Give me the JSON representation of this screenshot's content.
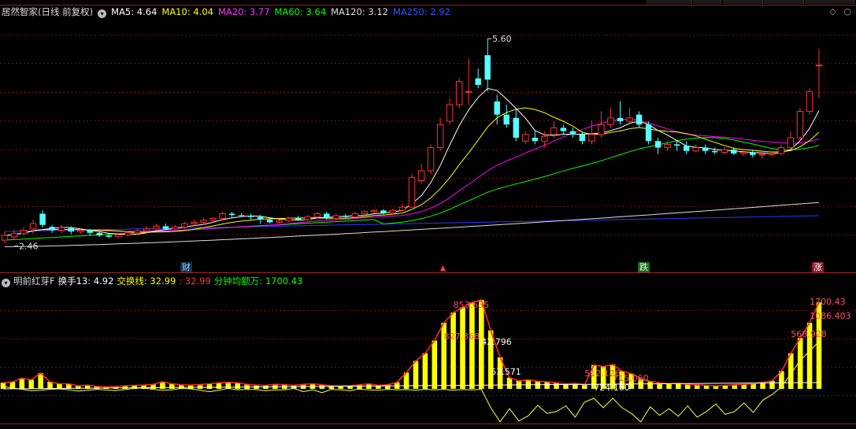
{
  "main_legend": {
    "title": "居然智家(日线 前复权)",
    "ma5": "MA5: 4.64",
    "ma10": "MA10: 4.04",
    "ma20": "MA20: 3.77",
    "ma60": "MA60: 3.64",
    "ma120": "MA120: 3.12",
    "ma250": "MA250: 2.92",
    "colors": {
      "ma5": "#ffffff",
      "ma10": "#ffff00",
      "ma20": "#ff00ff",
      "ma60": "#00ff00",
      "ma120": "#dddddd",
      "ma250": "#3333ff"
    }
  },
  "sub_legend": {
    "title": "明前红芽F",
    "turnover": "换手13: 4.92",
    "cross_label": "交换线: 32.99",
    "cross_value": ": 32.99",
    "amount": "分钟均额万: 1700.43"
  },
  "markers": {
    "cai": "财",
    "die": "跌",
    "zhang": "涨"
  },
  "chart_data": [
    {
      "type": "candlestick",
      "yrange": [
        2.3,
        5.9
      ],
      "annotations": [
        {
          "text": "5.60",
          "x_index": 51,
          "y": 5.6
        },
        {
          "text": "2.46",
          "x_index": 1,
          "y": 2.46
        }
      ],
      "candles": [
        [
          2.55,
          2.62,
          2.5,
          2.68
        ],
        [
          2.6,
          2.65,
          2.56,
          2.7
        ],
        [
          2.65,
          2.7,
          2.62,
          2.74
        ],
        [
          2.72,
          2.8,
          2.65,
          2.86
        ],
        [
          2.95,
          2.78,
          2.74,
          3.0
        ],
        [
          2.75,
          2.7,
          2.66,
          2.78
        ],
        [
          2.7,
          2.74,
          2.66,
          2.78
        ],
        [
          2.73,
          2.68,
          2.64,
          2.76
        ],
        [
          2.68,
          2.7,
          2.64,
          2.73
        ],
        [
          2.7,
          2.66,
          2.62,
          2.72
        ],
        [
          2.66,
          2.62,
          2.6,
          2.68
        ],
        [
          2.62,
          2.6,
          2.58,
          2.66
        ],
        [
          2.6,
          2.63,
          2.58,
          2.66
        ],
        [
          2.63,
          2.66,
          2.6,
          2.68
        ],
        [
          2.66,
          2.69,
          2.63,
          2.72
        ],
        [
          2.69,
          2.72,
          2.66,
          2.76
        ],
        [
          2.72,
          2.76,
          2.7,
          2.8
        ],
        [
          2.76,
          2.72,
          2.7,
          2.8
        ],
        [
          2.72,
          2.75,
          2.7,
          2.78
        ],
        [
          2.75,
          2.8,
          2.72,
          2.83
        ],
        [
          2.8,
          2.82,
          2.76,
          2.86
        ],
        [
          2.82,
          2.85,
          2.78,
          2.88
        ],
        [
          2.85,
          2.88,
          2.82,
          2.9
        ],
        [
          2.88,
          2.95,
          2.85,
          2.98
        ],
        [
          2.95,
          2.93,
          2.9,
          2.98
        ],
        [
          2.93,
          2.92,
          2.9,
          2.96
        ],
        [
          2.92,
          2.9,
          2.86,
          2.95
        ],
        [
          2.9,
          2.86,
          2.8,
          2.93
        ],
        [
          2.86,
          2.82,
          2.8,
          2.9
        ],
        [
          2.82,
          2.84,
          2.8,
          2.86
        ],
        [
          2.84,
          2.88,
          2.82,
          2.9
        ],
        [
          2.88,
          2.86,
          2.84,
          2.92
        ],
        [
          2.86,
          2.9,
          2.84,
          2.93
        ],
        [
          2.9,
          2.95,
          2.88,
          2.98
        ],
        [
          2.95,
          2.88,
          2.86,
          2.98
        ],
        [
          2.88,
          2.92,
          2.86,
          2.95
        ],
        [
          2.92,
          2.9,
          2.88,
          2.95
        ],
        [
          2.9,
          2.95,
          2.88,
          2.98
        ],
        [
          2.95,
          2.98,
          2.92,
          3.0
        ],
        [
          2.98,
          3.0,
          2.96,
          3.02
        ],
        [
          3.0,
          2.96,
          2.94,
          3.02
        ],
        [
          2.96,
          3.0,
          2.94,
          3.03
        ],
        [
          3.0,
          3.05,
          2.98,
          3.1
        ],
        [
          3.05,
          3.5,
          3.05,
          3.55
        ],
        [
          3.45,
          3.6,
          3.4,
          3.7
        ],
        [
          3.6,
          3.95,
          3.55,
          4.0
        ],
        [
          3.95,
          4.3,
          3.9,
          4.4
        ],
        [
          4.35,
          4.6,
          4.3,
          4.7
        ],
        [
          4.6,
          4.95,
          4.55,
          5.0
        ],
        [
          4.8,
          4.8,
          4.6,
          5.3
        ],
        [
          5.0,
          4.9,
          4.85,
          5.15
        ],
        [
          5.35,
          4.98,
          4.8,
          5.6
        ],
        [
          4.65,
          4.45,
          4.3,
          4.75
        ],
        [
          4.45,
          4.3,
          4.25,
          4.6
        ],
        [
          4.4,
          4.1,
          4.05,
          4.55
        ],
        [
          4.05,
          4.15,
          4.0,
          4.2
        ],
        [
          4.1,
          4.05,
          4.0,
          4.2
        ],
        [
          4.05,
          4.12,
          3.95,
          4.2
        ],
        [
          4.15,
          4.25,
          4.1,
          4.35
        ],
        [
          4.25,
          4.2,
          4.15,
          4.3
        ],
        [
          4.2,
          4.15,
          4.1,
          4.25
        ],
        [
          4.15,
          4.05,
          4.0,
          4.2
        ],
        [
          4.05,
          4.15,
          4.0,
          4.35
        ],
        [
          4.15,
          4.3,
          4.1,
          4.5
        ],
        [
          4.3,
          4.4,
          4.25,
          4.55
        ],
        [
          4.4,
          4.35,
          4.3,
          4.65
        ],
        [
          4.35,
          4.4,
          4.3,
          4.55
        ],
        [
          4.45,
          4.3,
          4.25,
          4.5
        ],
        [
          4.3,
          4.05,
          4.0,
          4.35
        ],
        [
          4.05,
          3.95,
          3.85,
          4.1
        ],
        [
          3.95,
          4.0,
          3.9,
          4.05
        ],
        [
          4.0,
          3.98,
          3.9,
          4.05
        ],
        [
          3.98,
          3.9,
          3.85,
          4.05
        ],
        [
          3.9,
          3.95,
          3.88,
          4.0
        ],
        [
          3.95,
          3.9,
          3.85,
          4.0
        ],
        [
          3.9,
          3.88,
          3.85,
          3.95
        ],
        [
          3.88,
          3.92,
          3.85,
          3.96
        ],
        [
          3.92,
          3.86,
          3.84,
          3.96
        ],
        [
          3.86,
          3.88,
          3.82,
          3.92
        ],
        [
          3.88,
          3.84,
          3.8,
          3.92
        ],
        [
          3.84,
          3.85,
          3.78,
          3.88
        ],
        [
          3.85,
          3.86,
          3.82,
          3.9
        ],
        [
          3.86,
          3.95,
          3.84,
          4.0
        ],
        [
          3.95,
          4.1,
          3.92,
          4.2
        ],
        [
          4.1,
          4.5,
          4.05,
          4.55
        ],
        [
          4.5,
          4.8,
          4.45,
          4.85
        ],
        [
          5.2,
          5.2,
          4.7,
          5.45
        ]
      ]
    },
    {
      "type": "bar+line",
      "yrange": [
        -45,
        1950
      ],
      "annotations": [
        {
          "text": "1700.43",
          "x_index": 86
        },
        {
          "text": "1086.403",
          "x_index": 86
        },
        {
          "text": "568.928",
          "x_index": 84
        },
        {
          "text": "853.635",
          "x_index": 48
        },
        {
          "text": "827.368",
          "x_index": 47
        },
        {
          "text": "42.796",
          "x_index": 51
        },
        {
          "text": "53.571",
          "x_index": 52
        },
        {
          "text": "512.126",
          "x_index": 62
        },
        {
          "text": "715.060",
          "x_index": 65
        },
        {
          "text": "724.160",
          "x_index": 63
        }
      ],
      "bars": [
        120,
        140,
        210,
        180,
        310,
        140,
        100,
        100,
        60,
        75,
        50,
        40,
        45,
        60,
        70,
        75,
        90,
        140,
        100,
        80,
        75,
        85,
        100,
        120,
        130,
        120,
        90,
        75,
        70,
        90,
        85,
        70,
        90,
        100,
        80,
        60,
        55,
        60,
        80,
        100,
        70,
        80,
        130,
        320,
        550,
        700,
        950,
        1300,
        1500,
        1600,
        1700,
        1750,
        1150,
        620,
        220,
        160,
        180,
        150,
        140,
        120,
        100,
        110,
        80,
        470,
        440,
        480,
        350,
        300,
        200,
        150,
        120,
        100,
        110,
        90,
        80,
        70,
        60,
        70,
        80,
        90,
        100,
        130,
        160,
        350,
        700,
        1000,
        1300,
        1700
      ],
      "line": [
        50,
        20,
        -10,
        -40,
        -30,
        -10,
        0,
        -20,
        -45,
        -30,
        -10,
        -25,
        -35,
        -15,
        10,
        20,
        -10,
        -30,
        -20,
        10,
        0,
        -30,
        -60,
        -30,
        10,
        -20,
        -10,
        -15,
        -40,
        -20,
        -20,
        10,
        -60,
        -20,
        -80,
        -10,
        -20,
        -40,
        -5,
        -20,
        -30,
        -10,
        -20,
        -15,
        -30,
        -10,
        -20,
        -10,
        -30,
        -15,
        -20,
        -10,
        -400,
        -700,
        -420,
        -680,
        -570,
        -350,
        -520,
        -480,
        -360,
        -600,
        -280,
        -200,
        -400,
        -200,
        -400,
        -520,
        -700,
        -380,
        -560,
        -420,
        -580,
        -360,
        -600,
        -480,
        -320,
        -540,
        -480,
        -300,
        -500,
        -240,
        -120,
        40,
        320,
        600,
        800,
        1000
      ]
    }
  ]
}
